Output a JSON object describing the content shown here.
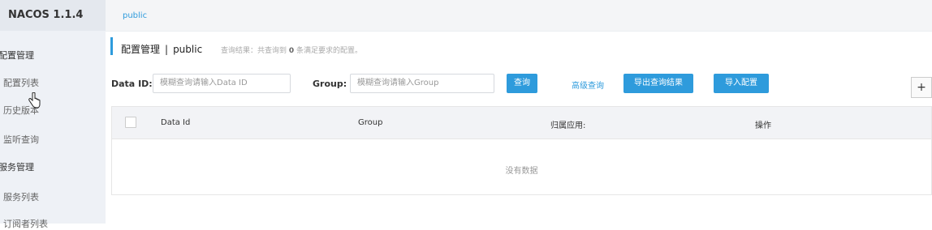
{
  "sidebar": {
    "logo": "NACOS 1.1.4",
    "groups": [
      {
        "label": "配置管理",
        "items": [
          "配置列表",
          "历史版本",
          "监听查询"
        ]
      },
      {
        "label": "服务管理",
        "items": [
          "服务列表",
          "订阅者列表"
        ]
      }
    ]
  },
  "topbar": {
    "namespace_tab": "public"
  },
  "header": {
    "title": "配置管理",
    "separator": "|",
    "namespace": "public",
    "result_prefix": "查询结果：共查询到",
    "result_count": "0",
    "result_suffix": "条满足要求的配置。"
  },
  "search": {
    "dataid_label": "Data ID:",
    "dataid_placeholder": "模糊查询请输入Data ID",
    "group_label": "Group:",
    "group_placeholder": "模糊查询请输入Group",
    "query_button": "查询",
    "advanced_link": "高级查询",
    "export_button": "导出查询结果",
    "import_button": "导入配置",
    "edge_button": "+"
  },
  "table": {
    "columns": [
      "Data Id",
      "Group",
      "归属应用:",
      "操作"
    ],
    "empty_text": "没有数据"
  },
  "colors": {
    "accent": "#2e9bdc",
    "sidebar_bg": "#eef1f6"
  }
}
